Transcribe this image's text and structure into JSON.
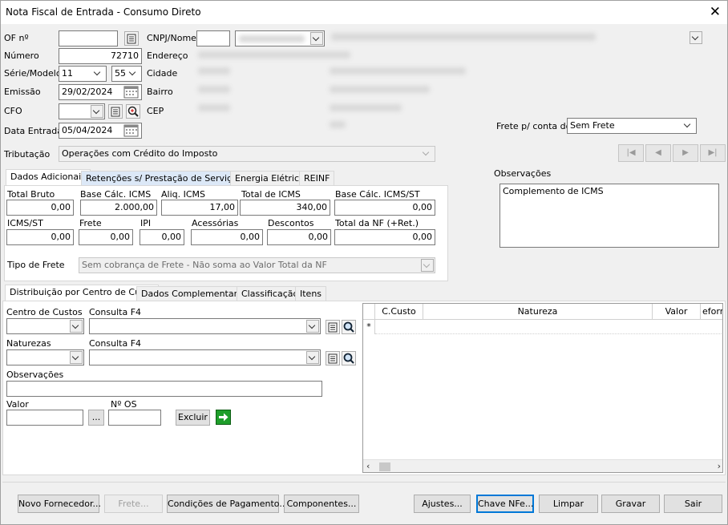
{
  "window": {
    "title": "Nota Fiscal de Entrada - Consumo Direto"
  },
  "header": {
    "of_label": "OF nº",
    "of_value": "",
    "numero_label": "Número",
    "numero_value": "72710",
    "serie_label": "Série/Modelo",
    "serie_value": "11",
    "modelo_value": "55",
    "emissao_label": "Emissão",
    "emissao_value": "29/02/2024",
    "cfo_label": "CFO",
    "cfo_value": "",
    "data_entrada_label": "Data Entrada",
    "data_entrada_value": "05/04/2024",
    "cnpj_label": "CNPJ/Nome",
    "endereco_label": "Endereço",
    "cidade_label": "Cidade",
    "bairro_label": "Bairro",
    "cep_label": "CEP",
    "frete_conta_label": "Frete p/ conta do",
    "frete_conta_value": "Sem Frete",
    "tributacao_label": "Tributação",
    "tributacao_value": "Operações com Crédito do Imposto"
  },
  "nav_buttons": [
    "|◀",
    "◀",
    "▶",
    "▶|"
  ],
  "tabs_top": {
    "items": [
      "Dados Adicionais",
      "Retenções s/ Prestação de Serviços",
      "Energia Elétrica",
      "REINF"
    ],
    "active": 0
  },
  "totals": {
    "total_bruto_label": "Total Bruto",
    "total_bruto": "0,00",
    "base_icms_label": "Base Cálc. ICMS",
    "base_icms": "2.000,00",
    "aliq_icms_label": "Aliq. ICMS",
    "aliq_icms": "17,00",
    "total_icms_label": "Total de ICMS",
    "total_icms": "340,00",
    "base_icms_st_label": "Base Cálc. ICMS/ST",
    "base_icms_st": "0,00",
    "icms_st_label": "ICMS/ST",
    "icms_st": "0,00",
    "frete_label": "Frete",
    "frete": "0,00",
    "ipi_label": "IPI",
    "ipi": "0,00",
    "acessorias_label": "Acessórias",
    "acessorias": "0,00",
    "descontos_label": "Descontos",
    "descontos": "0,00",
    "total_nf_label": "Total da NF (+Ret.)",
    "total_nf": "0,00",
    "tipo_frete_label": "Tipo de Frete",
    "tipo_frete_value": "Sem cobrança de Frete - Não soma ao Valor Total da NF"
  },
  "observacoes": {
    "label": "Observações",
    "value": "Complemento de ICMS"
  },
  "tabs_bottom": {
    "items": [
      "Distribuição por Centro de Custo",
      "Dados Complementares",
      "Classificação",
      "Itens"
    ],
    "active": 0
  },
  "distribution": {
    "centro_custos_label": "Centro de Custos",
    "consulta_f4_label": "Consulta F4",
    "naturezas_label": "Naturezas",
    "consulta_f4_label2": "Consulta F4",
    "observacoes_label": "Observações",
    "valor_label": "Valor",
    "nos_label": "Nº OS",
    "ellipsis_label": "...",
    "excluir_label": "Excluir"
  },
  "grid": {
    "columns": [
      "C.Custo",
      "Natureza",
      "Valor",
      "eform"
    ],
    "new_row_marker": "*"
  },
  "footer_buttons": {
    "novo_fornecedor": "Novo Fornecedor...",
    "frete": "Frete...",
    "condicoes": "Condições de Pagamento...",
    "componentes": "Componentes...",
    "ajustes": "Ajustes...",
    "chave_nfe": "Chave NFe...",
    "limpar": "Limpar",
    "gravar": "Gravar",
    "sair": "Sair"
  },
  "colors": {
    "focus": "#0078d7",
    "tab_highlight": "#dce8f7",
    "go_green": "#1e9e2a"
  }
}
